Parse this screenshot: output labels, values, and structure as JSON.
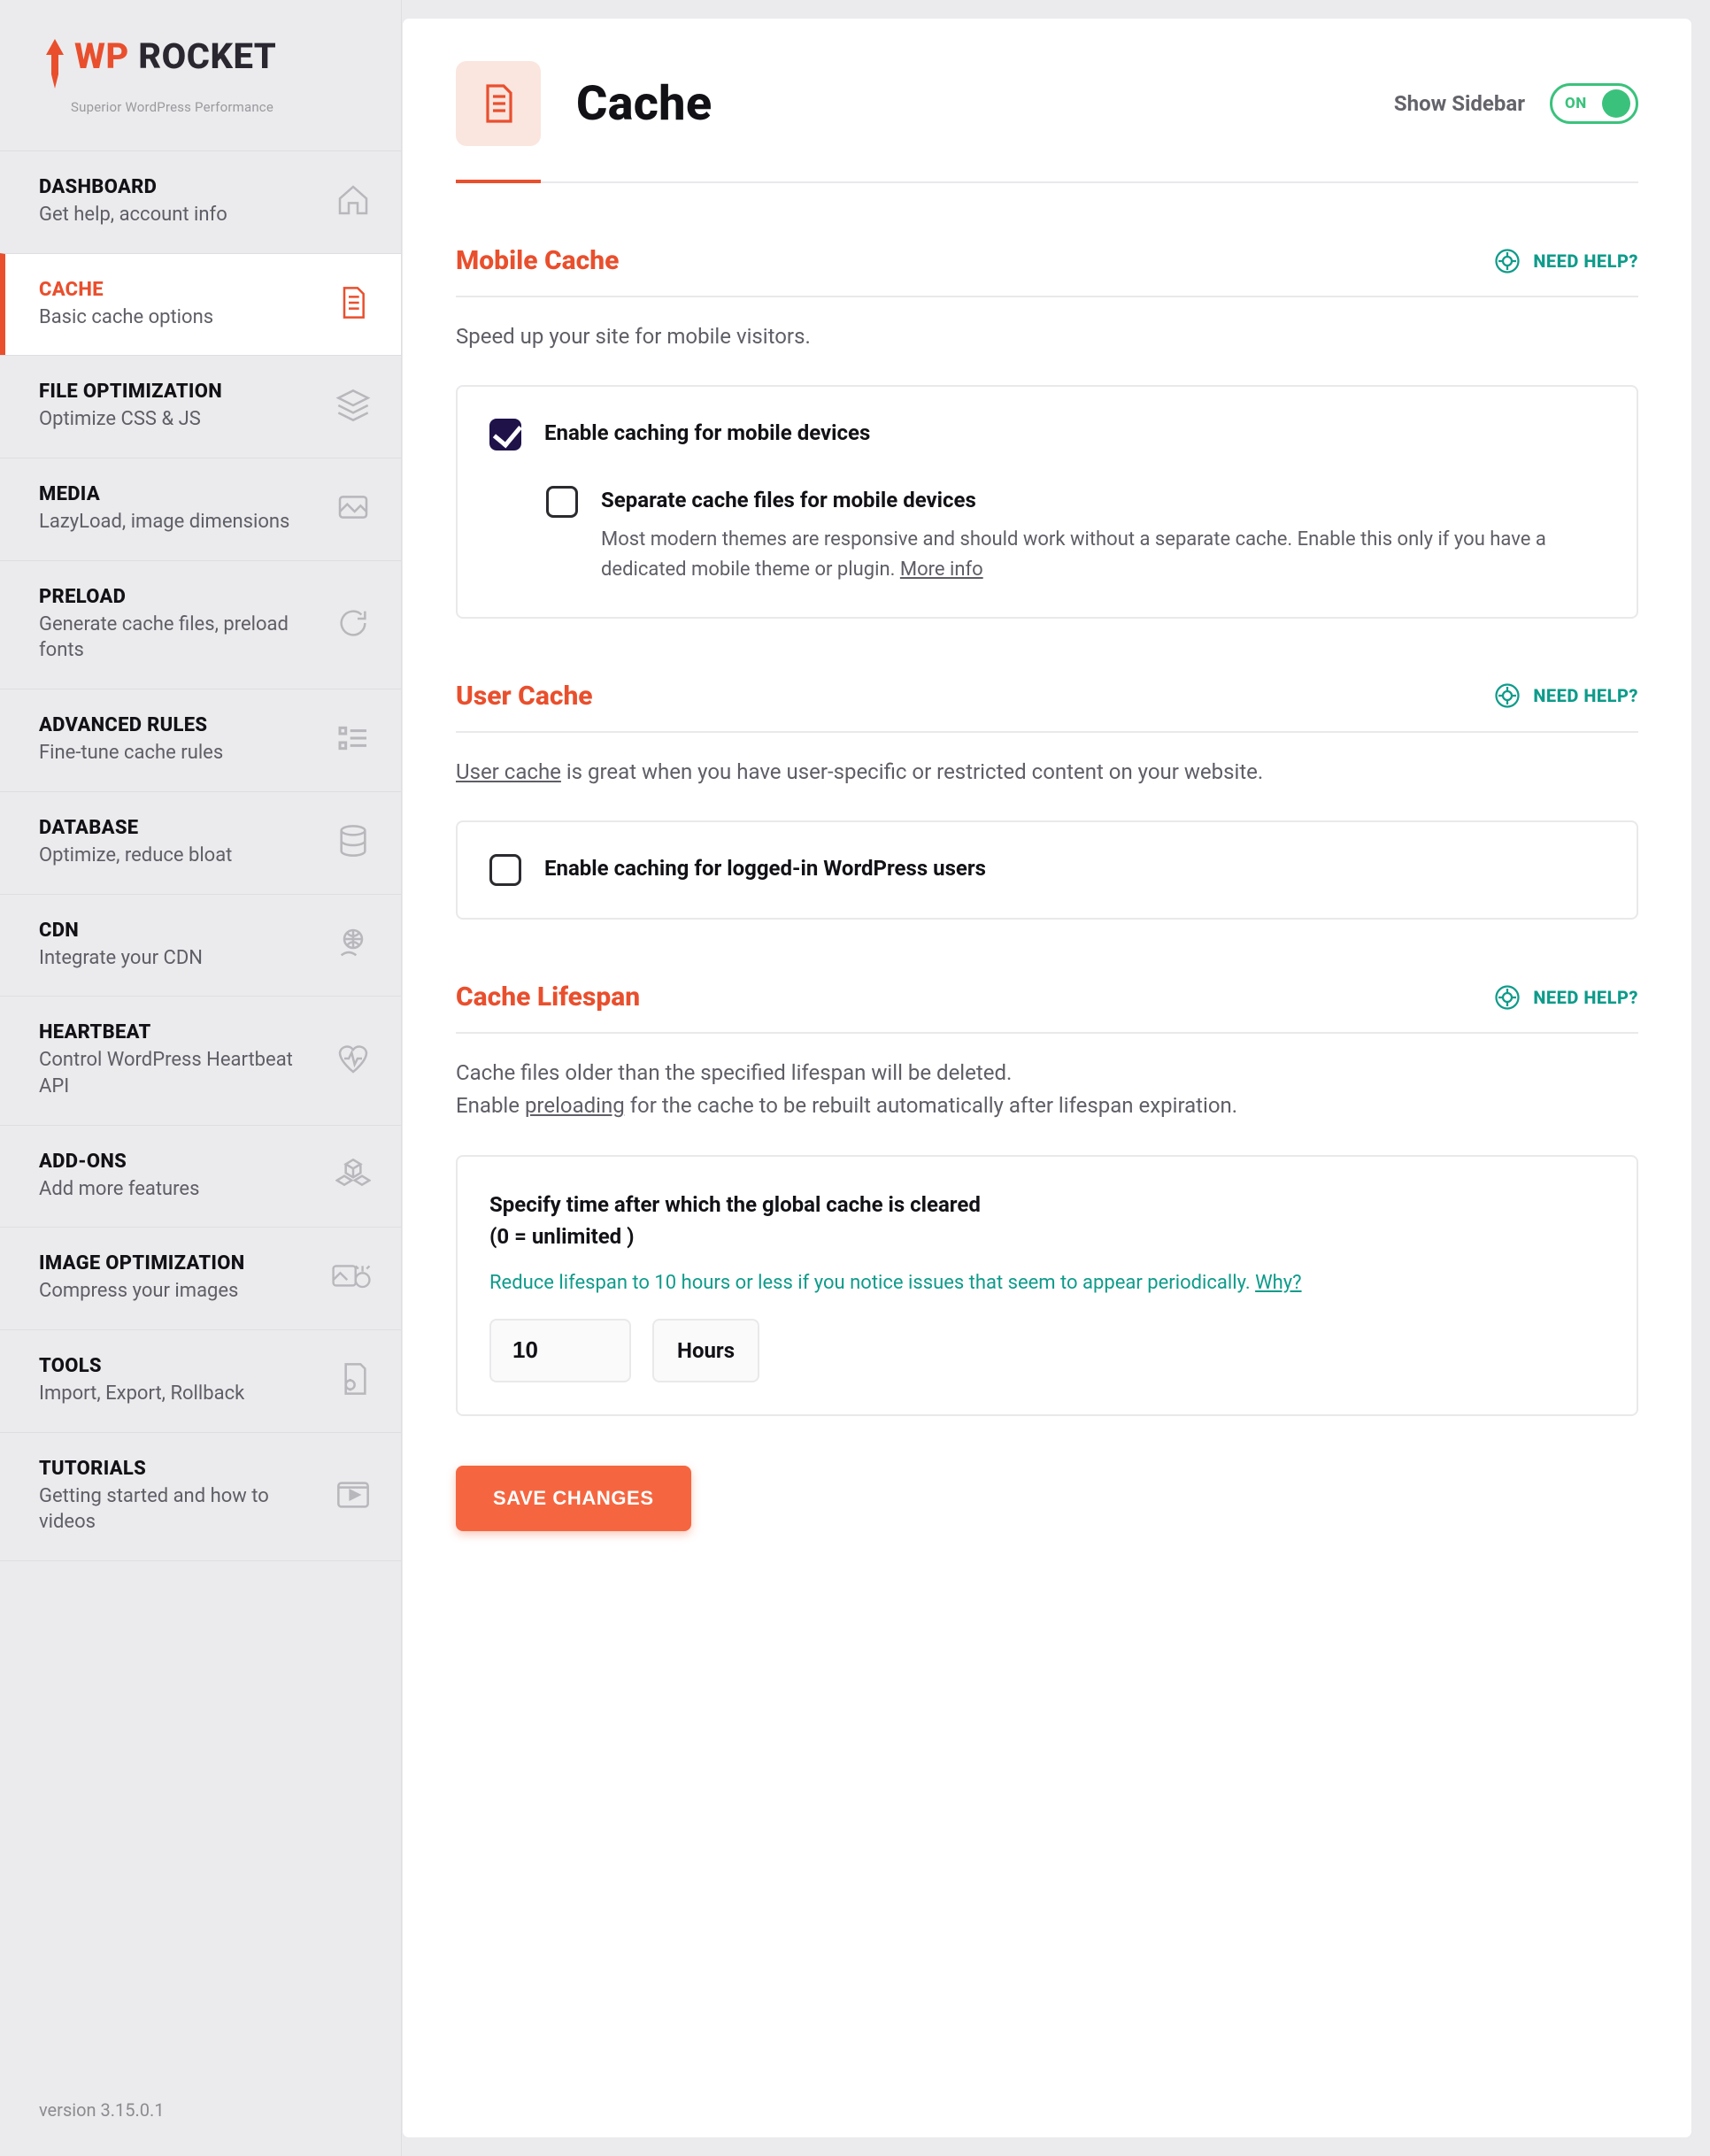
{
  "brand": {
    "wp": "WP",
    "rocket": " ROCKET",
    "tagline": "Superior WordPress Performance"
  },
  "sidebar": {
    "version": "version 3.15.0.1",
    "items": [
      {
        "title": "DASHBOARD",
        "sub": "Get help, account info",
        "icon": "home-icon"
      },
      {
        "title": "CACHE",
        "sub": "Basic cache options",
        "icon": "page-icon",
        "active": true
      },
      {
        "title": "FILE OPTIMIZATION",
        "sub": "Optimize CSS & JS",
        "icon": "stack-icon"
      },
      {
        "title": "MEDIA",
        "sub": "LazyLoad, image dimensions",
        "icon": "picture-icon"
      },
      {
        "title": "PRELOAD",
        "sub": "Generate cache files, preload fonts",
        "icon": "refresh-icon"
      },
      {
        "title": "ADVANCED RULES",
        "sub": "Fine-tune cache rules",
        "icon": "list-icon"
      },
      {
        "title": "DATABASE",
        "sub": "Optimize, reduce bloat",
        "icon": "database-icon"
      },
      {
        "title": "CDN",
        "sub": "Integrate your CDN",
        "icon": "globe-hand-icon"
      },
      {
        "title": "HEARTBEAT",
        "sub": "Control WordPress Heartbeat API",
        "icon": "heartbeat-icon"
      },
      {
        "title": "ADD-ONS",
        "sub": "Add more features",
        "icon": "cubes-icon"
      },
      {
        "title": "IMAGE OPTIMIZATION",
        "sub": "Compress your images",
        "icon": "image-compress-icon"
      },
      {
        "title": "TOOLS",
        "sub": "Import, Export, Rollback",
        "icon": "gear-page-icon"
      },
      {
        "title": "TUTORIALS",
        "sub": "Getting started and how to videos",
        "icon": "video-icon"
      }
    ]
  },
  "header": {
    "title": "Cache",
    "show_sidebar_label": "Show Sidebar",
    "toggle_on": "ON"
  },
  "help_label": "NEED HELP?",
  "mobile": {
    "title": "Mobile Cache",
    "desc": "Speed up your site for mobile visitors.",
    "opt1": "Enable caching for mobile devices",
    "opt2_title": "Separate cache files for mobile devices",
    "opt2_desc": "Most modern themes are responsive and should work without a separate cache. Enable this only if you have a dedicated mobile theme or plugin. ",
    "more_info": "More info"
  },
  "user": {
    "title": "User Cache",
    "desc_link": "User cache",
    "desc_rest": " is great when you have user-specific or restricted content on your website.",
    "opt1": "Enable caching for logged-in WordPress users"
  },
  "lifespan": {
    "title": "Cache Lifespan",
    "desc1": "Cache files older than the specified lifespan will be deleted.",
    "desc2a": "Enable ",
    "desc2_link": "preloading",
    "desc2b": " for the cache to be rebuilt automatically after lifespan expiration.",
    "box_title1": "Specify time after which the global cache is cleared",
    "box_title2": "(0 = unlimited )",
    "hint": "Reduce lifespan to 10 hours or less if you notice issues that seem to appear periodically. ",
    "why": "Why?",
    "value": "10",
    "unit": "Hours"
  },
  "save": "SAVE CHANGES"
}
